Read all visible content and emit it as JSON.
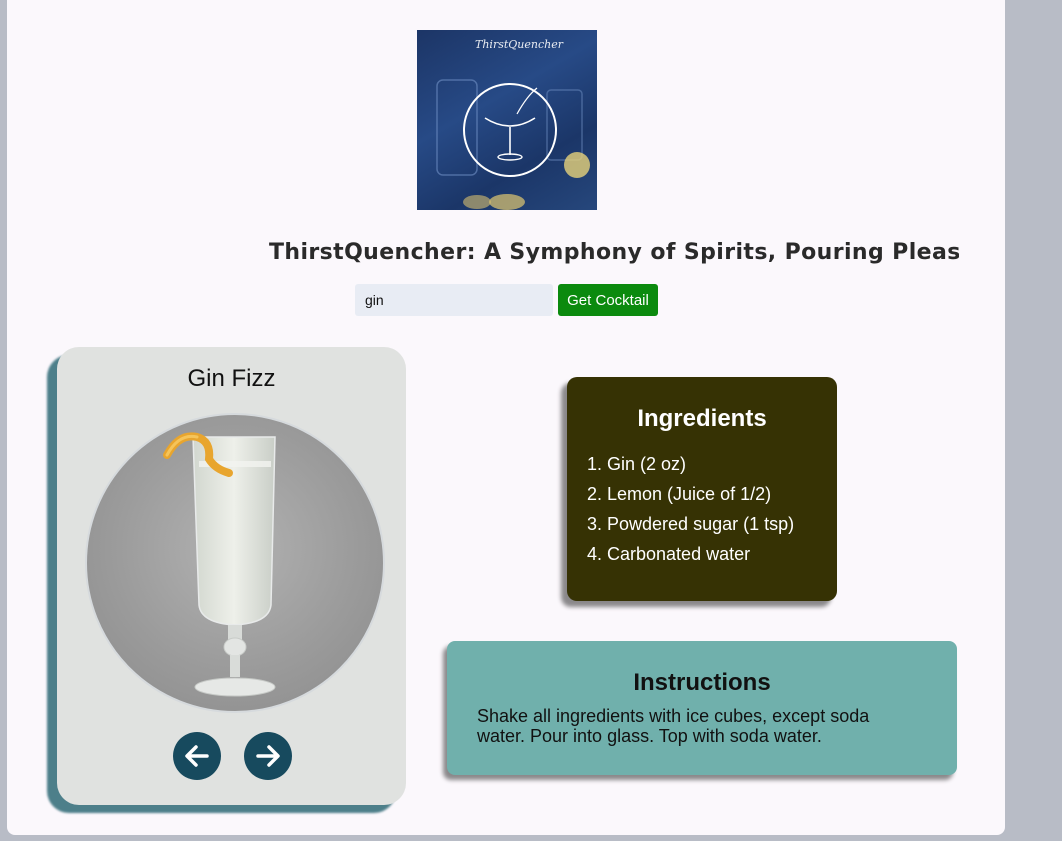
{
  "header": {
    "logo_text": "ThirstQuencher",
    "tagline": "ThirstQuencher: A Symphony of Spirits, Pouring Pleasure in Every Glass"
  },
  "search": {
    "value": "gin",
    "button_label": "Get Cocktail"
  },
  "drink": {
    "name": "Gin Fizz",
    "prev_icon": "arrow-left-icon",
    "next_icon": "arrow-right-icon"
  },
  "ingredients": {
    "title": "Ingredients",
    "items": [
      "1. Gin (2 oz)",
      "2. Lemon (Juice of 1/2)",
      "3. Powdered sugar (1 tsp)",
      "4. Carbonated water"
    ]
  },
  "instructions": {
    "title": "Instructions",
    "text": "Shake all ingredients with ice cubes, except soda water. Pour into glass. Top with soda water."
  },
  "colors": {
    "search_button": "#0b8a0e",
    "ingredients_bg": "#363204",
    "instructions_bg": "#70b0ac",
    "nav_button": "#174a5e",
    "card_shadow": "#4d7f8a"
  }
}
